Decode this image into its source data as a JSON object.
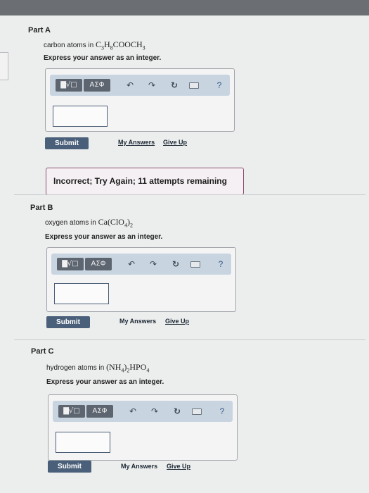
{
  "parts": [
    {
      "title": "Part A",
      "question_prefix": "carbon atoms in",
      "formula": "C3H8COOCH3",
      "express": "Express your answer as an integer.",
      "toolbar": {
        "templates_label": "▇√□",
        "greek_label": "ΑΣΦ",
        "help_label": "?"
      },
      "submit_label": "Submit",
      "my_answers_label": "My Answers",
      "give_up_label": "Give Up",
      "input_value": ""
    },
    {
      "title": "Part B",
      "question_prefix": "oxygen atoms in",
      "formula": "Ca(ClO4)2",
      "express": "Express your answer as an integer.",
      "toolbar": {
        "templates_label": "▇√□",
        "greek_label": "ΑΣΦ",
        "help_label": "?"
      },
      "submit_label": "Submit",
      "my_answers_label": "My Answers",
      "give_up_label": "Give Up",
      "input_value": ""
    },
    {
      "title": "Part C",
      "question_prefix": "hydrogen atoms in",
      "formula": "(NH4)2HPO4",
      "express": "Express your answer as an integer.",
      "toolbar": {
        "templates_label": "▇√□",
        "greek_label": "ΑΣΦ",
        "help_label": "?"
      },
      "submit_label": "Submit",
      "my_answers_label": "My Answers",
      "give_up_label": "Give Up",
      "input_value": ""
    }
  ],
  "feedback": {
    "text": "Incorrect; Try Again; 11 attempts remaining"
  },
  "colors": {
    "accent": "#4a5f79",
    "toolbar_bg": "#c8d5e1",
    "feedback_border": "#8f5070"
  }
}
